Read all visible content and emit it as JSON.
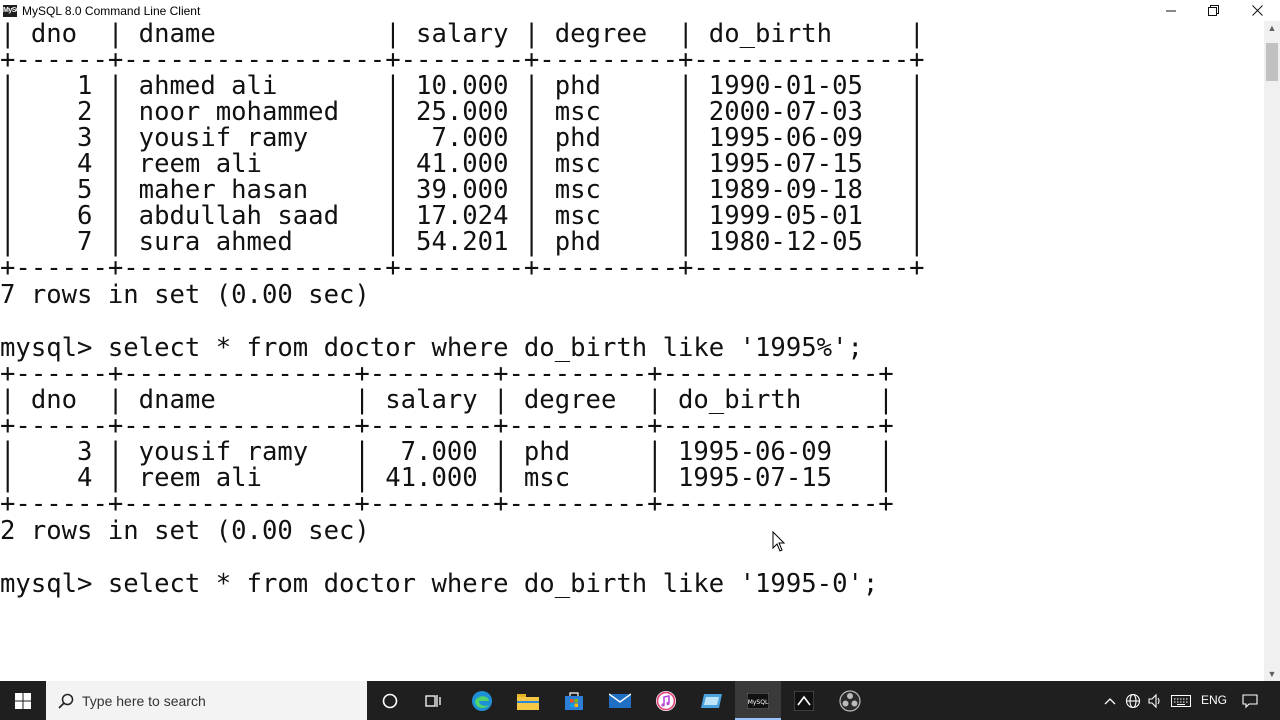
{
  "window": {
    "title": "MySQL 8.0 Command Line Client",
    "minimize": "—",
    "restore": "❐",
    "close": "✕"
  },
  "console": {
    "lines": [
      "| dno  | dname           | salary | degree  | do_birth     |",
      "+------+-----------------+--------+---------+--------------+",
      "|    1 | ahmed ali       | 10.000 | phd     | 1990-01-05   |",
      "|    2 | noor mohammed   | 25.000 | msc     | 2000-07-03   |",
      "|    3 | yousif ramy     |  7.000 | phd     | 1995-06-09   |",
      "|    4 | reem ali        | 41.000 | msc     | 1995-07-15   |",
      "|    5 | maher hasan     | 39.000 | msc     | 1989-09-18   |",
      "|    6 | abdullah saad   | 17.024 | msc     | 1999-05-01   |",
      "|    7 | sura ahmed      | 54.201 | phd     | 1980-12-05   |",
      "+------+-----------------+--------+---------+--------------+",
      "7 rows in set (0.00 sec)",
      "",
      "mysql> select * from doctor where do_birth like '1995%';",
      "+------+---------------+--------+---------+--------------+",
      "| dno  | dname         | salary | degree  | do_birth     |",
      "+------+---------------+--------+---------+--------------+",
      "|    3 | yousif ramy   |  7.000 | phd     | 1995-06-09   |",
      "|    4 | reem ali      | 41.000 | msc     | 1995-07-15   |",
      "+------+---------------+--------+---------+--------------+",
      "2 rows in set (0.00 sec)",
      "",
      "mysql> select * from doctor where do_birth like '1995-0';"
    ]
  },
  "scrollbar": {
    "up": "▲",
    "down": "▼"
  },
  "taskbar": {
    "search_placeholder": "Type here to search",
    "language": "ENG",
    "icons": [
      "windows-start-icon",
      "search-icon",
      "cortana-icon",
      "task-view-icon",
      "edge-icon",
      "file-explorer-icon",
      "store-icon",
      "mail-icon",
      "itunes-icon",
      "app-icon",
      "mysql-icon",
      "terminal-icon",
      "obs-icon"
    ]
  },
  "colors": {
    "taskbar": "#1f1f1f",
    "search_box": "#f3f3f3",
    "console_bg": "#ffffff",
    "console_text": "#111111"
  }
}
